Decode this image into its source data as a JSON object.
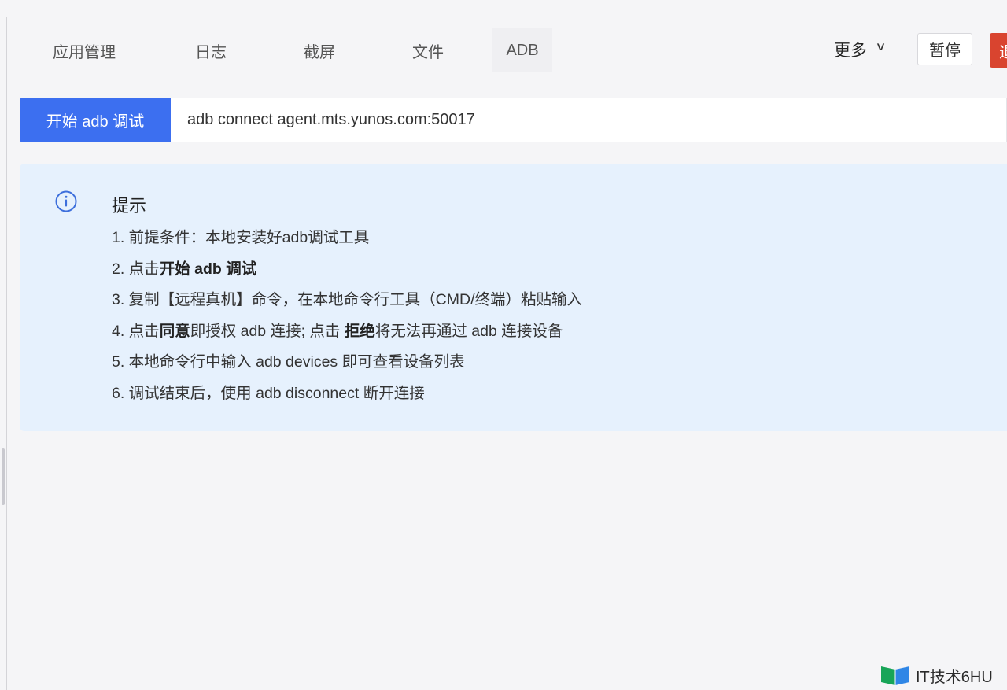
{
  "tabs": [
    {
      "label": "应用管理"
    },
    {
      "label": "日志"
    },
    {
      "label": "截屏"
    },
    {
      "label": "文件"
    },
    {
      "label": "ADB",
      "active": true
    }
  ],
  "header": {
    "more_label": "更多",
    "pause_label": "暂停",
    "exit_label": "退"
  },
  "adb": {
    "start_button_label": "开始 adb 调试",
    "command": "adb connect agent.mts.yunos.com:50017"
  },
  "tips": {
    "title": "提示",
    "lines": [
      [
        {
          "text": "1. 前提条件：本地安装好adb调试工具"
        }
      ],
      [
        {
          "text": "2. 点击"
        },
        {
          "text": "开始 adb 调试",
          "bold": true
        }
      ],
      [
        {
          "text": "3. 复制【远程真机】命令，在本地命令行工具（CMD/终端）粘贴输入"
        }
      ],
      [
        {
          "text": "4. 点击"
        },
        {
          "text": "同意",
          "bold": true
        },
        {
          "text": "即授权 adb 连接; 点击 "
        },
        {
          "text": "拒绝",
          "bold": true
        },
        {
          "text": "将无法再通过 adb 连接设备"
        }
      ],
      [
        {
          "text": "5. 本地命令行中输入 adb devices 即可查看设备列表"
        }
      ],
      [
        {
          "text": "6. 调试结束后，使用 adb disconnect 断开连接"
        }
      ]
    ]
  },
  "watermark": {
    "text": "IT技术6HU"
  },
  "icons": {
    "info": "info-circle-icon",
    "chevron": "chevron-down-icon",
    "logo": "book-logo-icon"
  },
  "colors": {
    "primary": "#3c6ff0",
    "danger": "#d9442f",
    "tip_bg": "#e6f1fd",
    "icon_blue": "#3d6fdc"
  }
}
